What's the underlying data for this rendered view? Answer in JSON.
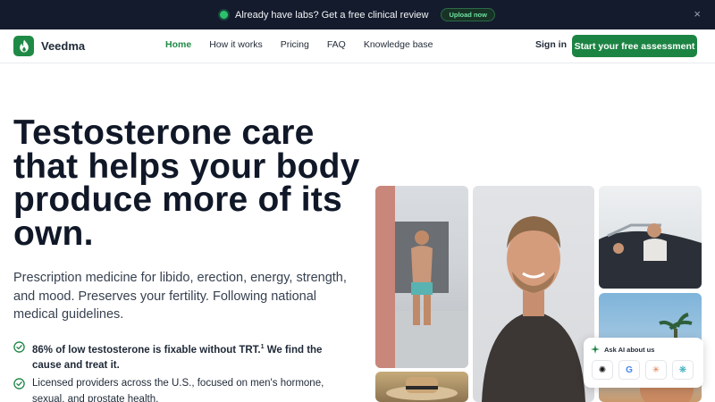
{
  "announcement": {
    "message": "Already have labs? Get a free clinical review",
    "pill_label": "Upload now",
    "close_glyph": "×",
    "dot_color": "#2bc26b"
  },
  "nav": {
    "brand": "Veedma",
    "brand_icon": "flame-icon",
    "items": [
      {
        "label": "Home",
        "active": true
      },
      {
        "label": "How it works",
        "active": false
      },
      {
        "label": "Pricing",
        "active": false
      },
      {
        "label": "FAQ",
        "active": false
      },
      {
        "label": "Knowledge base",
        "active": false
      }
    ],
    "signin_label": "Sign in",
    "cta_label": "Start your free assessment"
  },
  "hero": {
    "headline": "Testosterone care that helps your body produce more of its own.",
    "subheadline": "Prescription medicine for libido, erection, energy, strength, and mood. Preserves your fertility. Following national medical guidelines.",
    "features": [
      {
        "text": "86% of low testosterone is fixable without TRT.",
        "sup": "1",
        "text_after": " We find the cause and treat it."
      },
      {
        "text": "Licensed providers across the U.S., focused on men's hormone, sexual, and prostate health."
      }
    ]
  },
  "ask_ai": {
    "title": "Ask AI about us",
    "providers": [
      {
        "name": "openai-icon",
        "glyph": "✺"
      },
      {
        "name": "google-icon",
        "glyph": "G"
      },
      {
        "name": "claude-icon",
        "glyph": "✳"
      },
      {
        "name": "perplexity-icon",
        "glyph": "❋"
      }
    ]
  },
  "colors": {
    "brand_green": "#1c8443",
    "topbar_bg": "#141b2d",
    "heading": "#101828"
  }
}
